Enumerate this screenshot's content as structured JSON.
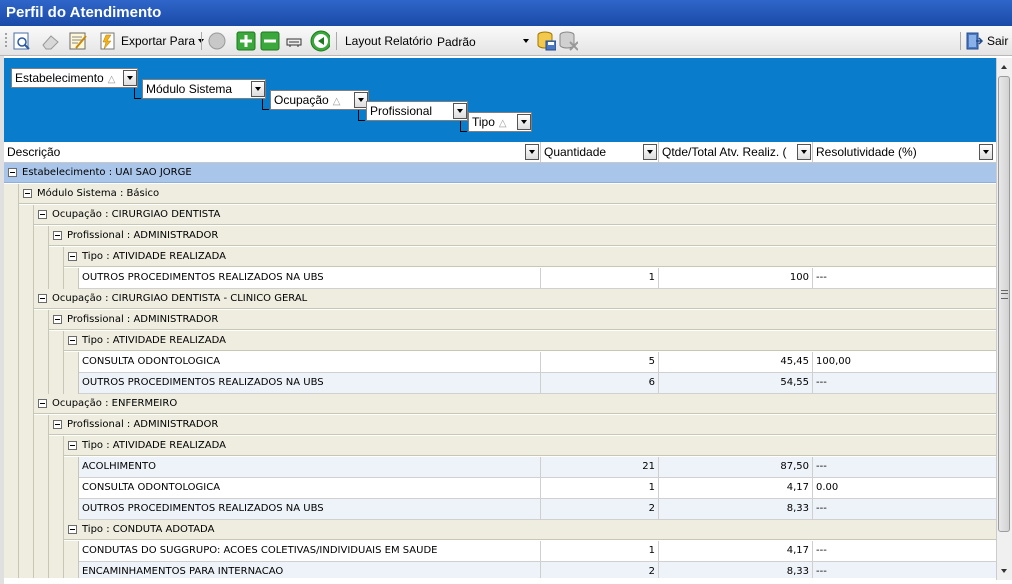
{
  "window": {
    "title": "Perfil do Atendimento"
  },
  "toolbar": {
    "export_label": "Exportar Para",
    "layout_label": "Layout Relatório",
    "layout_value": "Padrão",
    "exit_label": "Sair"
  },
  "group_panel": {
    "chips": [
      "Estabelecimento",
      "Módulo Sistema",
      "Ocupação",
      "Profissional",
      "Tipo"
    ]
  },
  "columns": {
    "descricao": "Descrição",
    "quantidade": "Quantidade",
    "qtde_total": "Qtde/Total Atv. Realiz. (",
    "resolutividade": "Resolutividade (%)"
  },
  "groups": {
    "estab": "Estabelecimento : UAI SAO JORGE",
    "modulo": "Módulo Sistema : Básico",
    "ocup1": "Ocupação : CIRURGIAO DENTISTA",
    "prof1": "Profissional : ADMINISTRADOR",
    "tipo1": "Tipo : ATIVIDADE REALIZADA",
    "ocup2": "Ocupação : CIRURGIAO DENTISTA - CLINICO GERAL",
    "prof2": "Profissional : ADMINISTRADOR",
    "tipo2": "Tipo : ATIVIDADE REALIZADA",
    "ocup3": "Ocupação : ENFERMEIRO",
    "prof3": "Profissional : ADMINISTRADOR",
    "tipo3": "Tipo : ATIVIDADE REALIZADA",
    "tipo4": "Tipo : CONDUTA ADOTADA"
  },
  "rows": [
    {
      "desc": "OUTROS PROCEDIMENTOS REALIZADOS NA UBS",
      "qtd": "1",
      "tot": "100",
      "res": "---"
    },
    {
      "desc": "CONSULTA ODONTOLOGICA",
      "qtd": "5",
      "tot": "45,45",
      "res": "100,00"
    },
    {
      "desc": "OUTROS PROCEDIMENTOS REALIZADOS NA UBS",
      "qtd": "6",
      "tot": "54,55",
      "res": "---"
    },
    {
      "desc": "ACOLHIMENTO",
      "qtd": "21",
      "tot": "87,50",
      "res": "---"
    },
    {
      "desc": "CONSULTA ODONTOLOGICA",
      "qtd": "1",
      "tot": "4,17",
      "res": "0.00"
    },
    {
      "desc": "OUTROS PROCEDIMENTOS REALIZADOS NA UBS",
      "qtd": "2",
      "tot": "8,33",
      "res": "---"
    },
    {
      "desc": "CONDUTAS DO SUGGRUPO: ACOES COLETIVAS/INDIVIDUAIS EM SAUDE",
      "qtd": "1",
      "tot": "4,17",
      "res": "---"
    },
    {
      "desc": "ENCAMINHAMENTOS PARA INTERNACAO",
      "qtd": "2",
      "tot": "8,33",
      "res": "---"
    }
  ],
  "colors": {
    "title_bar": "#1a4aa8",
    "group_panel": "#0a7ccc",
    "group_row_top": "#a9c6ea",
    "group_row": "#efede0",
    "alt_row": "#eef3fa"
  }
}
